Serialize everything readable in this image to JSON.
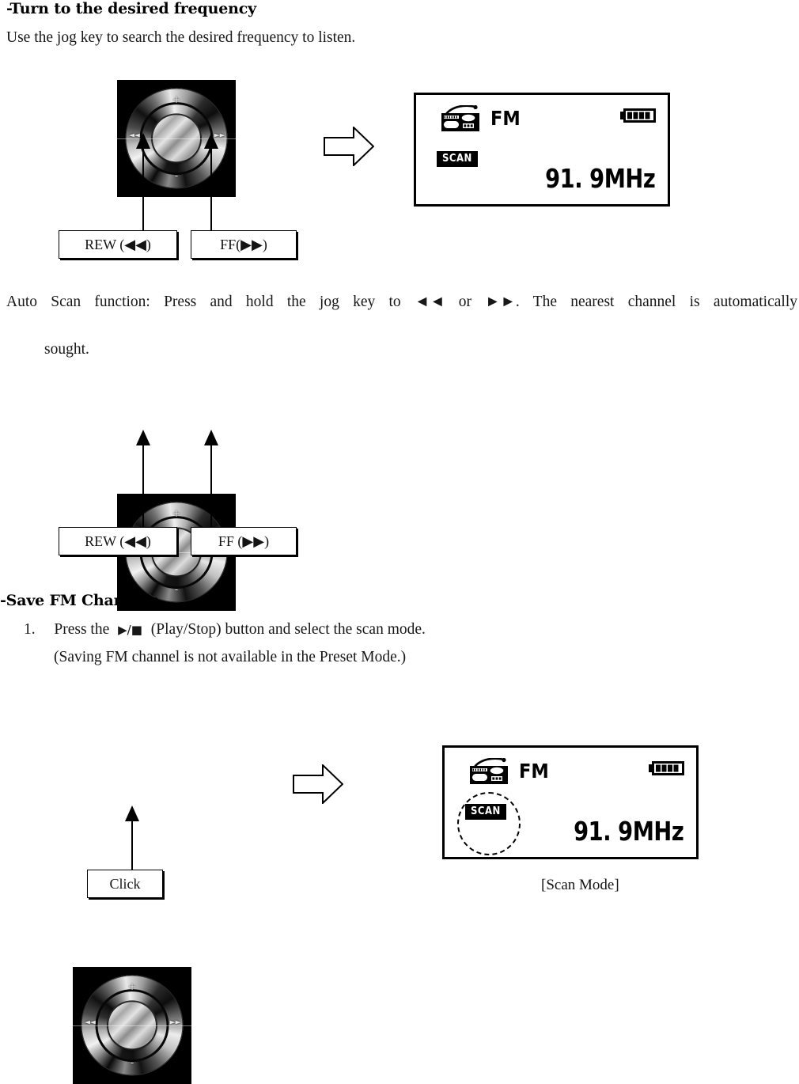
{
  "document": {
    "sections": [
      {
        "heading": "-Turn to the desired frequency",
        "intro": "Use the jog key to search the desired frequency to listen."
      },
      {
        "heading": "-Save FM Channels"
      }
    ],
    "auto_scan": {
      "line1": "Auto Scan function: Press and hold the jog key to ◄◄ or ►►. The nearest channel is automatically",
      "line2": "sought."
    },
    "step1": {
      "number": "1.",
      "text_before": "Press the",
      "glyph": "▶/■",
      "text_after": "(Play/Stop) button and select the scan mode.",
      "note": "(Saving FM channel is not available in the Preset Mode.)"
    }
  },
  "callouts": {
    "rew_1": "REW (◀◀)",
    "ff_1": "FF(▶▶)",
    "rew_2": "REW (◀◀)",
    "ff_2": "FF (▶▶)",
    "click": "Click"
  },
  "jog_dial": {
    "mark_plus": "+",
    "mark_minus": "-",
    "mark_prev": "◄◄",
    "mark_next": "►►",
    "alt": "jog key photo"
  },
  "lcd_top": {
    "radio_icon": "radio-icon",
    "band": "FM",
    "battery_icon": "battery-full-icon",
    "battery_bars": 4,
    "scan_badge": "SCAN",
    "frequency": "91. 9MHz"
  },
  "lcd_bottom": {
    "radio_icon": "radio-icon",
    "band": "FM",
    "battery_icon": "battery-full-icon",
    "battery_bars": 4,
    "scan_badge": "SCAN",
    "frequency": "91. 9MHz",
    "caption": "[Scan Mode]"
  },
  "colors": {
    "ink": "#000000",
    "paper": "#ffffff",
    "body_text": "#171717"
  }
}
